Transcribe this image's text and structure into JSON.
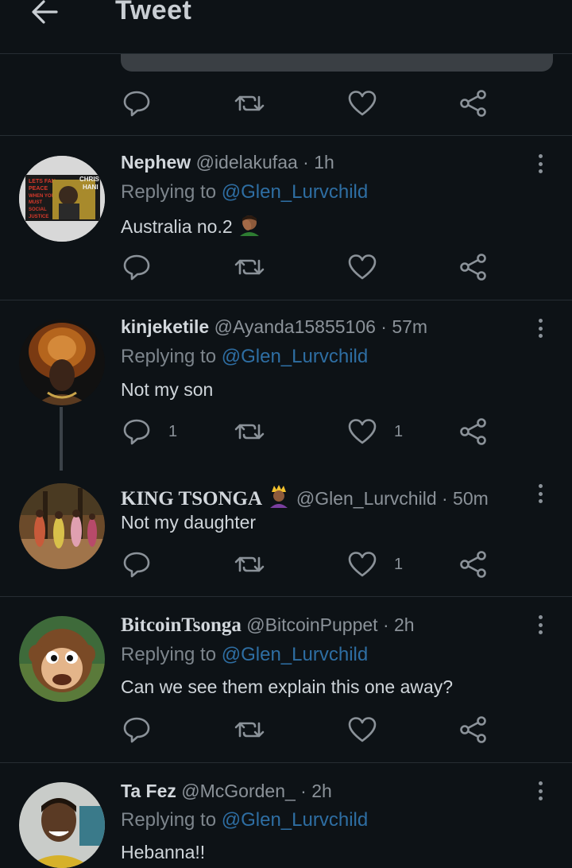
{
  "header": {
    "title": "Tweet"
  },
  "reply_label": "Replying to",
  "tweets": [
    {
      "name": "Nephew",
      "handle": "@idelakufaa · 1h",
      "replying_to": "@Glen_Lurvchild",
      "text": "Australia no.2",
      "reply_count": "",
      "like_count": ""
    },
    {
      "name": "kinjeketile",
      "handle": "@Ayanda15855106 · 57m",
      "replying_to": "@Glen_Lurvchild",
      "text": "Not my son",
      "reply_count": "1",
      "like_count": "1"
    },
    {
      "name": "KING TSONGA",
      "handle": "@Glen_Lurvchild · 50m",
      "text": "Not my daughter",
      "reply_count": "",
      "like_count": "1"
    },
    {
      "name": "BitcoinTsonga",
      "handle": "@BitcoinPuppet · 2h",
      "replying_to": "@Glen_Lurvchild",
      "text": "Can we see them explain this one away?",
      "reply_count": "",
      "like_count": ""
    },
    {
      "name": "Ta Fez",
      "handle": "@McGorden_ · 2h",
      "replying_to": "@Glen_Lurvchild",
      "text": "Hebanna!!"
    }
  ],
  "avatar_poster": {
    "line1": "LETS FAN",
    "line2": "PEACE",
    "line3": "WHEN YOU",
    "line4": "MUST",
    "line5": "SOCIAL",
    "line6": "JUSTICE",
    "badge1": "CHRIS",
    "badge2": "HANI"
  },
  "colors": {
    "background": "#0d1216",
    "link": "#2e6ea3",
    "muted": "#8b9299",
    "divider": "#262d33"
  }
}
